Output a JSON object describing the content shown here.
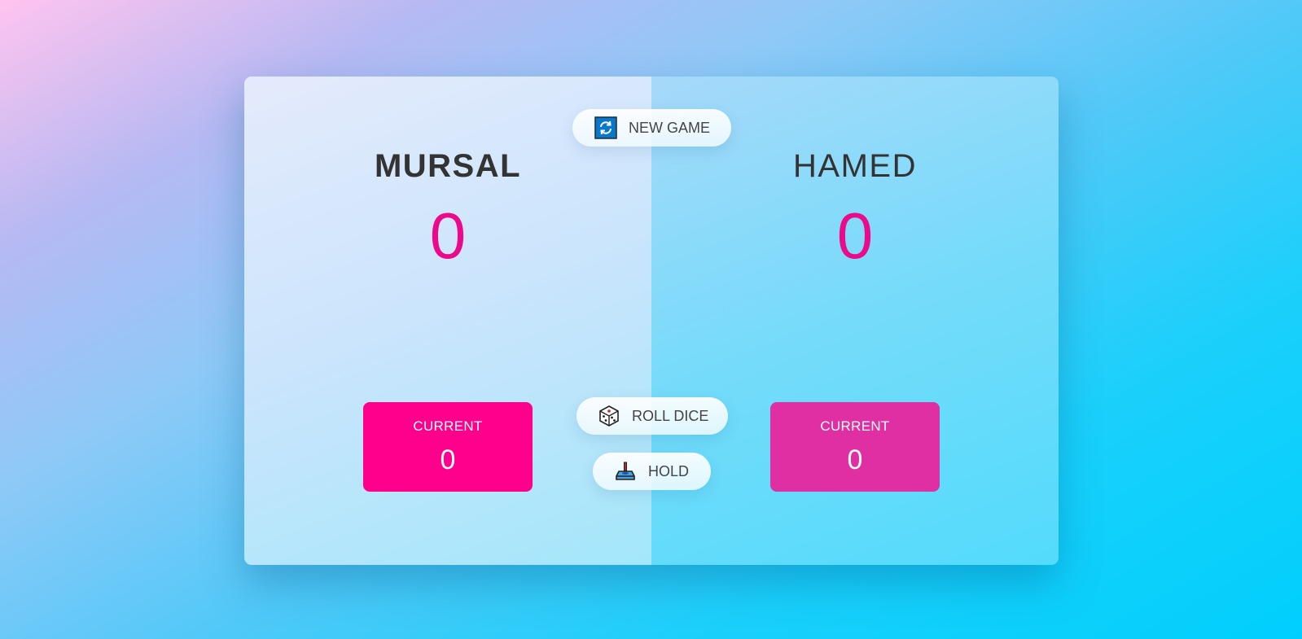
{
  "players": [
    {
      "name": "MURSAL",
      "score": "0",
      "current_label": "CURRENT",
      "current_score": "0",
      "active": true,
      "current_color": "#ff008d"
    },
    {
      "name": "HAMED",
      "score": "0",
      "current_label": "CURRENT",
      "current_score": "0",
      "active": false,
      "current_color": "#e02ea3"
    }
  ],
  "buttons": {
    "new_game": {
      "label": "NEW GAME",
      "icon": "refresh-icon"
    },
    "roll_dice": {
      "label": "ROLL DICE",
      "icon": "dice-icon"
    },
    "hold": {
      "label": "HOLD",
      "icon": "joystick-icon"
    }
  },
  "colors": {
    "score": "#ea0a8a",
    "text": "#333333"
  }
}
